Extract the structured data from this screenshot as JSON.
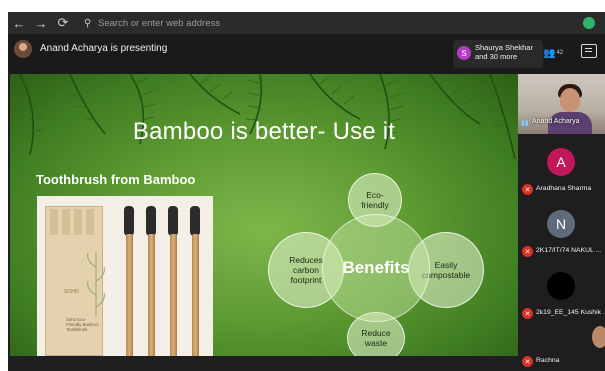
{
  "browser": {
    "back_icon": "back-arrow-icon",
    "forward_icon": "forward-arrow-icon",
    "reload_icon": "reload-icon",
    "address_placeholder": "Search or enter web address"
  },
  "meeting": {
    "presenter_label": "Anand Acharya is presenting",
    "badge_initial": "S",
    "badge_text": "Shaurya Shekhar and 30 more",
    "people_count": "42"
  },
  "slide": {
    "title": "Bamboo is better- Use it",
    "subtitle": "Toothbrush from Bamboo",
    "box_brand": "SOHO",
    "box_text": "Soho Eco-Friendly Bamboo Toothbrush",
    "benefits": {
      "center": "Benefits",
      "top": "Eco-\nfriendly",
      "left": "Reduces\ncarbon\nfootprint",
      "right": "Easily\ncompostable",
      "bottom": "Reduce\nwaste"
    }
  },
  "participants": [
    {
      "name": "Anand Acharya",
      "type": "video"
    },
    {
      "name": "Aradhana Sharma",
      "initial": "A",
      "color": "#c2185b"
    },
    {
      "name": "2K17/IT/74 NAKUL ...",
      "initial": "N",
      "color": "#5f6b7a"
    },
    {
      "name": "2k19_EE_145 Kushik ...",
      "initial": "",
      "color": "#000000"
    },
    {
      "name": "Rachna",
      "type": "video-partial"
    }
  ]
}
